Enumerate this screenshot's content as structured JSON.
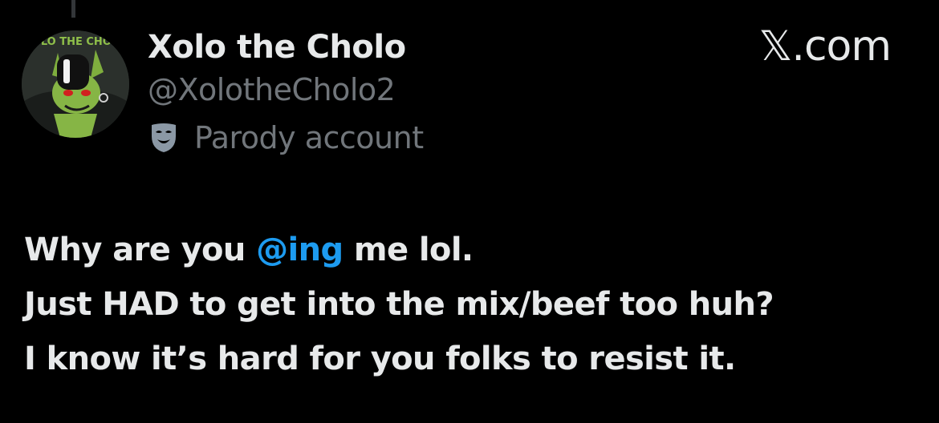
{
  "brand": "𝕏.com",
  "author": {
    "display_name": "Xolo the Cholo",
    "handle": "@XolotheCholo2",
    "label": "Parody account",
    "label_icon": "theater-mask-icon",
    "avatar_text": "XOLO THE CHOLO"
  },
  "tweet": {
    "line1_before": "Why are you ",
    "line1_mention": "@ing",
    "line1_after": " me lol.",
    "line2": "Just HAD to get into the mix/beef too huh?",
    "line3": "I know it’s hard for you folks to resist it."
  },
  "colors": {
    "background": "#000000",
    "text": "#e7e9ea",
    "secondary": "#71767b",
    "link": "#1d9bf0",
    "avatar_accent": "#8fbf4a"
  }
}
